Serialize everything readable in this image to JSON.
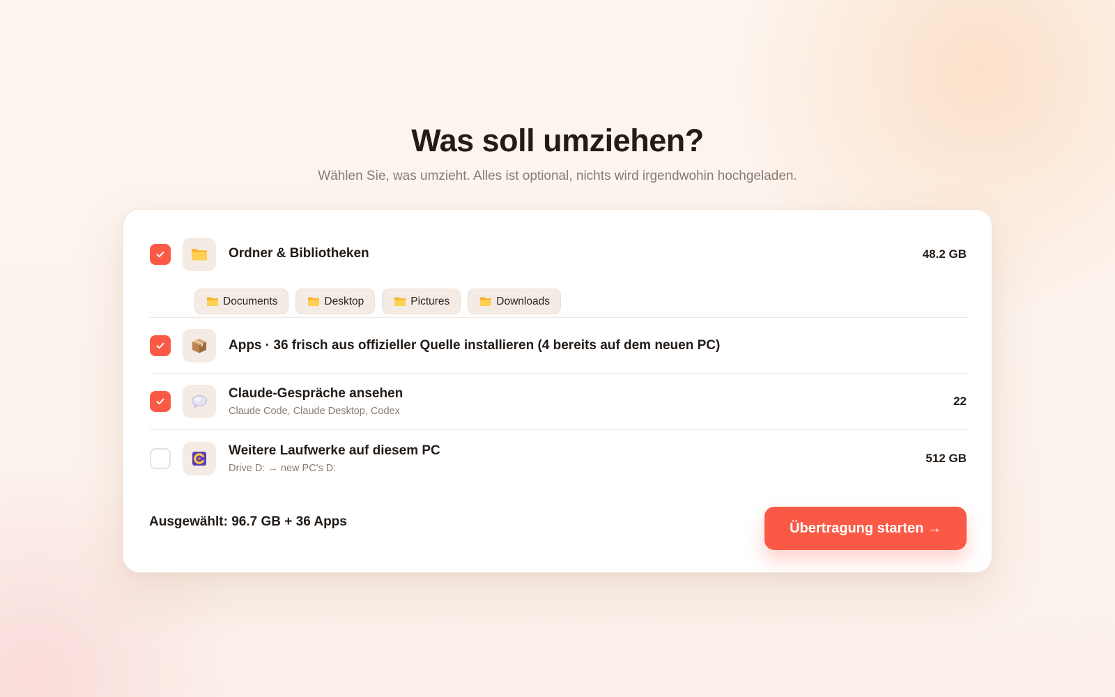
{
  "header": {
    "title": "Was soll umziehen?",
    "subtitle": "Wählen Sie, was umzieht. Alles ist optional, nichts wird irgendwohin hochgeladen."
  },
  "items": [
    {
      "title": "Ordner & Bibliotheken",
      "value": "48.2 GB",
      "checked": true,
      "icon": "folder-icon",
      "chips": [
        "Documents",
        "Desktop",
        "Pictures",
        "Downloads"
      ]
    },
    {
      "title": "Apps · 36 frisch aus offizieller Quelle installieren (4 bereits auf dem neuen PC)",
      "checked": true,
      "icon": "package-icon"
    },
    {
      "title": "Claude-Gespräche ansehen",
      "subtitle": "Claude Code, Claude Desktop, Codex",
      "value": "22",
      "checked": true,
      "icon": "chat-bubble-icon"
    },
    {
      "title": "Weitere Laufwerke auf diesem PC",
      "subtitle": "Drive D: → new PC's D:",
      "value": "512 GB",
      "checked": false,
      "icon": "drive-icon"
    }
  ],
  "footer": {
    "summary": "Ausgewählt: 96.7 GB + 36 Apps",
    "start_label": "Übertragung starten →"
  },
  "colors": {
    "accent": "#fa5a45",
    "text": "#231b16",
    "muted": "#8b7a70",
    "tile": "#f4ebe4"
  }
}
